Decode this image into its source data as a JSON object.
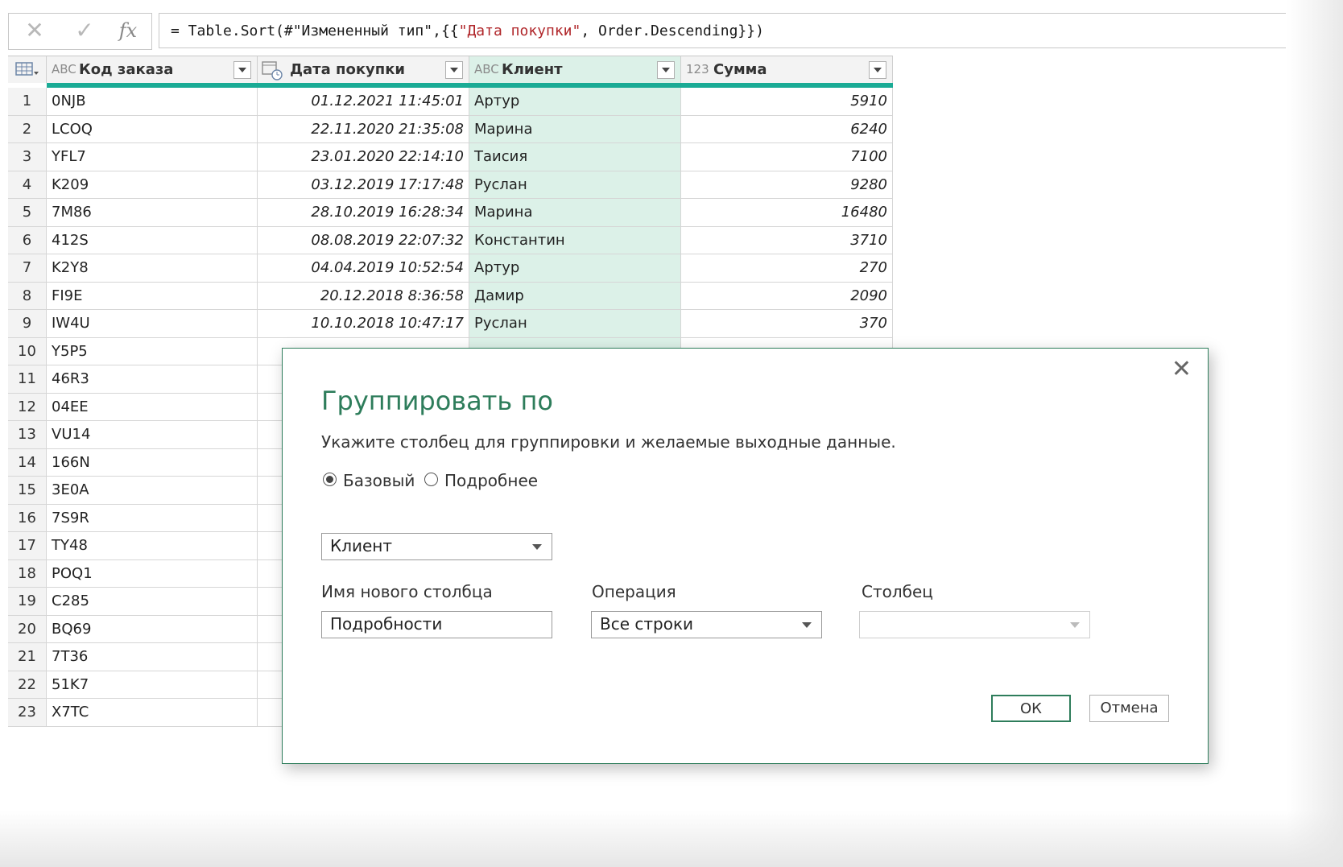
{
  "formula_bar": {
    "cancel_icon": "close-icon",
    "confirm_icon": "check-icon",
    "fx_label": "fx",
    "formula_prefix": "= Table.Sort(#\"Измененный тип\",{{",
    "formula_string": "\"Дата покупки\"",
    "formula_suffix": ", Order.Descending}})"
  },
  "table": {
    "columns": [
      {
        "type_label": "ABC",
        "name": "Код заказа"
      },
      {
        "type_label": "calendar-clock-icon",
        "name": "Дата покупки"
      },
      {
        "type_label": "ABC",
        "name": "Клиент"
      },
      {
        "type_label": "123",
        "name": "Сумма"
      }
    ],
    "rows": [
      {
        "n": "1",
        "code": "0NJB",
        "date": "01.12.2021 11:45:01",
        "client": "Артур",
        "sum": "5910"
      },
      {
        "n": "2",
        "code": "LCOQ",
        "date": "22.11.2020 21:35:08",
        "client": "Марина",
        "sum": "6240"
      },
      {
        "n": "3",
        "code": "YFL7",
        "date": "23.01.2020 22:14:10",
        "client": "Таисия",
        "sum": "7100"
      },
      {
        "n": "4",
        "code": "K209",
        "date": "03.12.2019 17:17:48",
        "client": "Руслан",
        "sum": "9280"
      },
      {
        "n": "5",
        "code": "7M86",
        "date": "28.10.2019 16:28:34",
        "client": "Марина",
        "sum": "16480"
      },
      {
        "n": "6",
        "code": "412S",
        "date": "08.08.2019 22:07:32",
        "client": "Константин",
        "sum": "3710"
      },
      {
        "n": "7",
        "code": "K2Y8",
        "date": "04.04.2019 10:52:54",
        "client": "Артур",
        "sum": "270"
      },
      {
        "n": "8",
        "code": "FI9E",
        "date": "20.12.2018 8:36:58",
        "client": "Дамир",
        "sum": "2090"
      },
      {
        "n": "9",
        "code": "IW4U",
        "date": "10.10.2018 10:47:17",
        "client": "Руслан",
        "sum": "370"
      },
      {
        "n": "10",
        "code": "Y5P5",
        "date": "",
        "client": "",
        "sum": ""
      },
      {
        "n": "11",
        "code": "46R3",
        "date": "",
        "client": "",
        "sum": ""
      },
      {
        "n": "12",
        "code": "04EE",
        "date": "",
        "client": "",
        "sum": ""
      },
      {
        "n": "13",
        "code": "VU14",
        "date": "",
        "client": "",
        "sum": ""
      },
      {
        "n": "14",
        "code": "166N",
        "date": "",
        "client": "",
        "sum": ""
      },
      {
        "n": "15",
        "code": "3E0A",
        "date": "",
        "client": "",
        "sum": ""
      },
      {
        "n": "16",
        "code": "7S9R",
        "date": "",
        "client": "",
        "sum": ""
      },
      {
        "n": "17",
        "code": "TY48",
        "date": "",
        "client": "",
        "sum": ""
      },
      {
        "n": "18",
        "code": "POQ1",
        "date": "",
        "client": "",
        "sum": ""
      },
      {
        "n": "19",
        "code": "C285",
        "date": "",
        "client": "",
        "sum": ""
      },
      {
        "n": "20",
        "code": "BQ69",
        "date": "",
        "client": "",
        "sum": ""
      },
      {
        "n": "21",
        "code": "7T36",
        "date": "",
        "client": "",
        "sum": ""
      },
      {
        "n": "22",
        "code": "51K7",
        "date": "",
        "client": "",
        "sum": ""
      },
      {
        "n": "23",
        "code": "X7TC",
        "date": "",
        "client": "",
        "sum": ""
      }
    ]
  },
  "dialog": {
    "title": "Группировать по",
    "subtitle": "Укажите столбец для группировки и желаемые выходные данные.",
    "radio_basic": "Базовый",
    "radio_advanced": "Подробнее",
    "group_by_value": "Клиент",
    "new_column_label": "Имя нового столбца",
    "new_column_value": "Подробности",
    "operation_label": "Операция",
    "operation_value": "Все строки",
    "column_label": "Столбец",
    "column_value": "",
    "ok_label": "ОК",
    "cancel_label": "Отмена",
    "accent_color": "#2e7d5b"
  }
}
